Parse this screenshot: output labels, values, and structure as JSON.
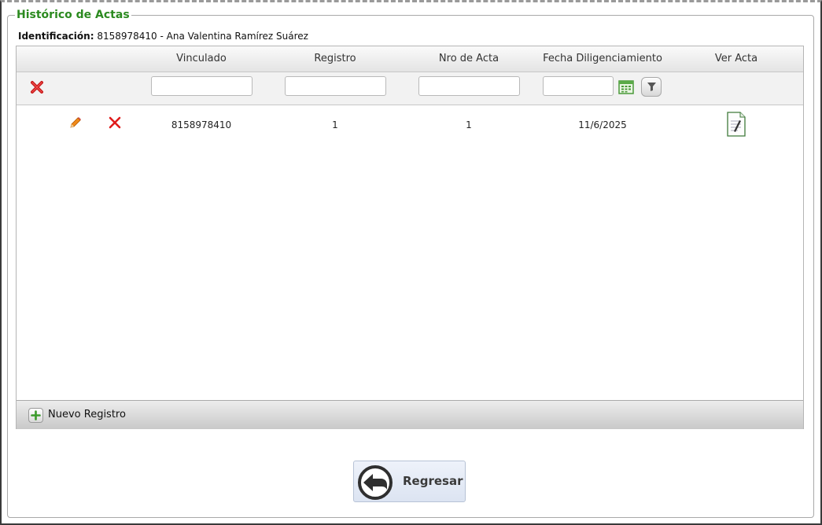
{
  "panel": {
    "legend": "Histórico de Actas",
    "ident_label": "Identificación:",
    "ident_value": "8158978410 - Ana Valentina Ramírez Suárez"
  },
  "grid": {
    "columns": [
      "Vinculado",
      "Registro",
      "Nro de Acta",
      "Fecha Diligenciamiento",
      "Ver Acta"
    ],
    "rows": [
      {
        "vinculado": "8158978410",
        "registro": "1",
        "nro_acta": "1",
        "fecha": "11/6/2025"
      }
    ],
    "footer_add_label": "Nuevo Registro"
  },
  "actions": {
    "back_label": "Regresar"
  },
  "colors": {
    "legend": "#2b8a1f",
    "delete": "#e01b1b",
    "edit": "#e07a12",
    "add": "#3a9a2a"
  },
  "icons": {
    "clear_filters": "clear-filter-x-icon",
    "calendar": "calendar-icon",
    "filter": "funnel-filter-icon",
    "edit": "pencil-edit-icon",
    "delete": "delete-x-icon",
    "view_document": "document-view-icon",
    "add": "plus-icon",
    "back": "back-arrow-icon"
  }
}
